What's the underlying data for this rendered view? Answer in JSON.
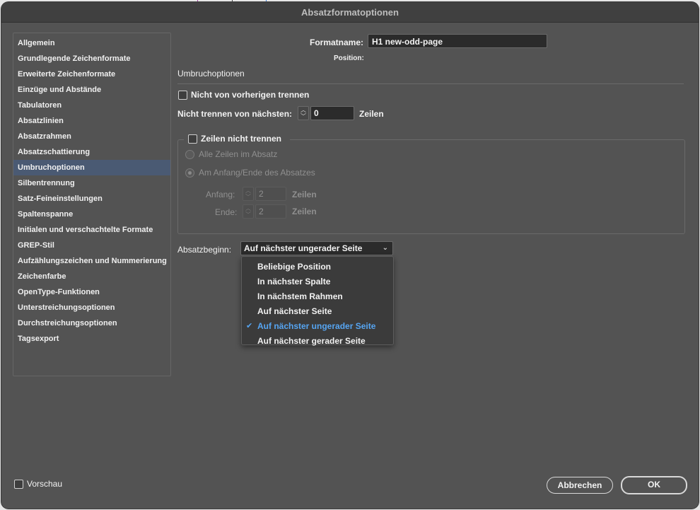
{
  "window": {
    "title": "Absatzformatoptionen"
  },
  "sidebar": {
    "items": [
      "Allgemein",
      "Grundlegende Zeichenformate",
      "Erweiterte Zeichenformate",
      "Einzüge und Abstände",
      "Tabulatoren",
      "Absatzlinien",
      "Absatzrahmen",
      "Absatzschattierung",
      "Umbruchoptionen",
      "Silbentrennung",
      "Satz-Feineinstellungen",
      "Spaltenspanne",
      "Initialen und verschachtelte Formate",
      "GREP-Stil",
      "Aufzählungszeichen und Nummerierung",
      "Zeichenfarbe",
      "OpenType-Funktionen",
      "Unterstreichungsoptionen",
      "Durchstreichungsoptionen",
      "Tagsexport"
    ],
    "selected": "Umbruchoptionen"
  },
  "header": {
    "format_name_label": "Formatname:",
    "format_name_value": "H1 new-odd-page",
    "position_label": "Position:"
  },
  "section": {
    "title": "Umbruchoptionen"
  },
  "options": {
    "keep_with_previous_label": "Nicht von vorherigen trennen",
    "keep_with_next_label": "Nicht trennen von nächsten:",
    "keep_with_next_value": "0",
    "keep_with_next_unit": "Zeilen"
  },
  "keep_lines": {
    "label": "Zeilen nicht trennen",
    "all_lines_label": "Alle Zeilen im Absatz",
    "start_end_label": "Am Anfang/Ende des Absatzes",
    "start_label": "Anfang:",
    "start_value": "2",
    "start_unit": "Zeilen",
    "end_label": "Ende:",
    "end_value": "2",
    "end_unit": "Zeilen"
  },
  "paragraph_start": {
    "label": "Absatzbeginn:",
    "selected": "Auf nächster ungerader Seite",
    "options": [
      "Beliebige Position",
      "In nächster Spalte",
      "In nächstem Rahmen",
      "Auf nächster Seite",
      "Auf nächster ungerader Seite",
      "Auf nächster gerader Seite"
    ]
  },
  "footer": {
    "preview_label": "Vorschau",
    "cancel_label": "Abbrechen",
    "ok_label": "OK"
  }
}
